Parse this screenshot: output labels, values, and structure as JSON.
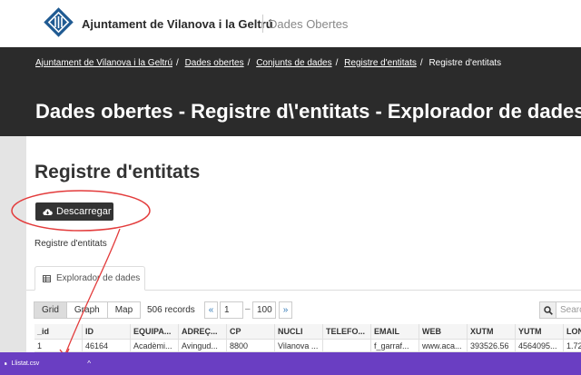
{
  "header": {
    "site_name": "Ajuntament de Vilanova i la Geltrú",
    "site_subtitle": "Dades Obertes"
  },
  "breadcrumb": [
    {
      "label": "Ajuntament de Vilanova i la Geltrú",
      "link": true
    },
    {
      "label": "Dades obertes",
      "link": true
    },
    {
      "label": "Conjunts de dades",
      "link": true
    },
    {
      "label": "Registre d'entitats",
      "link": true
    },
    {
      "label": "Registre d'entitats",
      "link": false
    }
  ],
  "hero": {
    "title": "Dades obertes - Registre d\\'entitats - Explorador de dades"
  },
  "resource": {
    "title": "Registre d'entitats",
    "download_label": "Descarregar",
    "description": "Registre d'entitats"
  },
  "explorer": {
    "tab_label": "Explorador de dades",
    "views": [
      "Grid",
      "Graph",
      "Map"
    ],
    "active_view": "Grid",
    "records": "506 records",
    "pager_prev": "«",
    "pager_from": "1",
    "pager_dash": "–",
    "pager_to": "100",
    "pager_next": "»",
    "search_placeholder": "Search"
  },
  "grid": {
    "columns": [
      "_id",
      "ID",
      "EQUIPA...",
      "ADREÇ...",
      "CP",
      "NUCLI",
      "TELEFO...",
      "EMAIL",
      "WEB",
      "XUTM",
      "YUTM",
      "LON"
    ],
    "rows": [
      [
        "1",
        "46164",
        "Acadèmi...",
        "Avingud...",
        "8800",
        "Vilanova ...",
        "",
        "f_garraf...",
        "www.aca...",
        "393526.56",
        "4564095...",
        "1.72"
      ]
    ]
  },
  "taskbar": {
    "download_file": "Llistat.csv",
    "caret": "^"
  },
  "colors": {
    "hero_bg": "#2b2b2b",
    "taskbar_bg": "#6a3ec2",
    "annotation": "#e33b3b",
    "link": "#337ab7"
  }
}
